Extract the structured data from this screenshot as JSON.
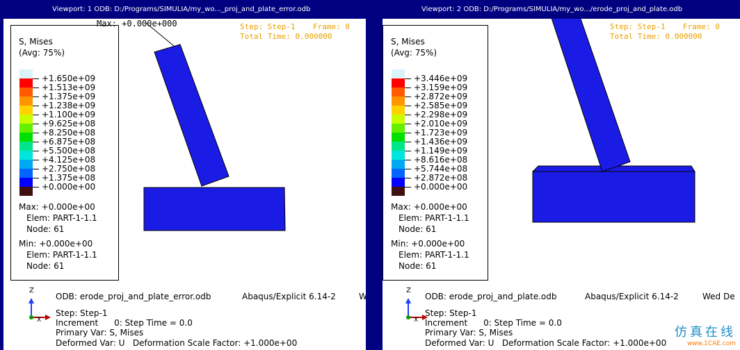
{
  "viewports": [
    {
      "title": "Viewport: 1    ODB: D:/Programs/SIMULIA/my_wo..._proj_and_plate_error.odb",
      "legend": {
        "title1": "S, Mises",
        "title2": "(Avg: 75%)",
        "labels": [
          "+1.650e+09",
          "+1.513e+09",
          "+1.375e+09",
          "+1.238e+09",
          "+1.100e+09",
          "+9.625e+08",
          "+8.250e+08",
          "+6.875e+08",
          "+5.500e+08",
          "+4.125e+08",
          "+2.750e+08",
          "+1.375e+08",
          "+0.000e+00"
        ],
        "max_line": "Max: +0.000e+00",
        "max_elem": "Elem: PART-1-1.1",
        "max_node": "Node: 61",
        "min_line": "Min: +0.000e+00",
        "min_elem": "Elem: PART-1-1.1",
        "min_node": "Node: 61"
      },
      "max_annotation": "Max: +0.000e+000",
      "status": {
        "step": "Step: Step-1",
        "frame": "Frame: 0",
        "time": "Total Time: 0.000000"
      },
      "info": {
        "odb": "ODB: erode_proj_and_plate_error.odb",
        "solver": "Abaqus/Explicit 6.14-2",
        "date": "W",
        "step": "Step: Step-1",
        "increment": "Increment      0: Step Time = 0.0",
        "primary": "Primary Var: S, Mises",
        "deformed": "Deformed Var: U   Deformation Scale Factor: +1.000e+00"
      },
      "triad": {
        "z": "Z",
        "x": "X"
      }
    },
    {
      "title": "Viewport: 2    ODB: D:/Programs/SIMULIA/my_wo.../erode_proj_and_plate.odb",
      "legend": {
        "title1": "S, Mises",
        "title2": "(Avg: 75%)",
        "labels": [
          "+3.446e+09",
          "+3.159e+09",
          "+2.872e+09",
          "+2.585e+09",
          "+2.298e+09",
          "+2.010e+09",
          "+1.723e+09",
          "+1.436e+09",
          "+1.149e+09",
          "+8.616e+08",
          "+5.744e+08",
          "+2.872e+08",
          "+0.000e+00"
        ],
        "max_line": "Max: +0.000e+00",
        "max_elem": "Elem: PART-1-1.1",
        "max_node": "Node: 61",
        "min_line": "Min: +0.000e+00",
        "min_elem": "Elem: PART-1-1.1",
        "min_node": "Node: 61"
      },
      "status": {
        "step": "Step: Step-1",
        "frame": "Frame: 0",
        "time": "Total Time: 0.000000"
      },
      "info": {
        "odb": "ODB: erode_proj_and_plate.odb",
        "solver": "Abaqus/Explicit 6.14-2",
        "date": "Wed De",
        "step": "Step: Step-1",
        "increment": "Increment      0: Step Time = 0.0",
        "primary": "Primary Var: S, Mises",
        "deformed": "Deformed Var: U   Deformation Scale Factor: +1.000e+00"
      },
      "triad": {
        "z": "Z",
        "x": "X"
      }
    }
  ],
  "contour_colors": [
    "#d8f4f8",
    "#ff0000",
    "#ff5a00",
    "#ff9600",
    "#ffd200",
    "#c8ff00",
    "#64f000",
    "#00e000",
    "#00e68c",
    "#00e6dc",
    "#00aaf0",
    "#0064ff",
    "#0000ff",
    "#401010"
  ],
  "part_color": "#1b1be6",
  "status_color": "#e8a000",
  "watermark": {
    "cn": "仿真在线",
    "url": "www.1CAE.com"
  }
}
